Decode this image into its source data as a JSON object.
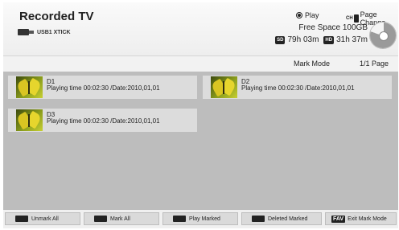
{
  "header": {
    "title": "Recorded TV",
    "usb_label": "USB1 XTICK",
    "play_label": "Play",
    "ch_label": "CH",
    "page_change_label": "Page Change",
    "free_space": "Free Space 100GB",
    "sd_badge": "SD",
    "sd_time": "79h 03m",
    "hd_badge": "HD",
    "hd_time": "31h 37m",
    "disk_used_fraction": 0.8
  },
  "mode_row": {
    "mode_label": "Mark Mode",
    "page": "1/1 Page"
  },
  "items": [
    {
      "name": "D1",
      "info": "Playing time 00:02:30 /Date:2010,01,01"
    },
    {
      "name": "D2",
      "info": "Playing time 00:02:30 /Date:2010,01,01"
    },
    {
      "name": "D3",
      "info": "Playing time 00:02:30 /Date:2010,01,01"
    }
  ],
  "footer": {
    "unmark_all": "Unmark All",
    "mark_all": "Mark All",
    "play_marked": "Play Marked",
    "deleted_marked": "Deleted Marked",
    "fav_badge": "FAV",
    "exit_mark_mode": "Exit Mark Mode"
  },
  "colors": {
    "content_bg": "#bdbdbd",
    "item_bg": "#dcdcdc",
    "header_bg": "#f5f5f5"
  }
}
